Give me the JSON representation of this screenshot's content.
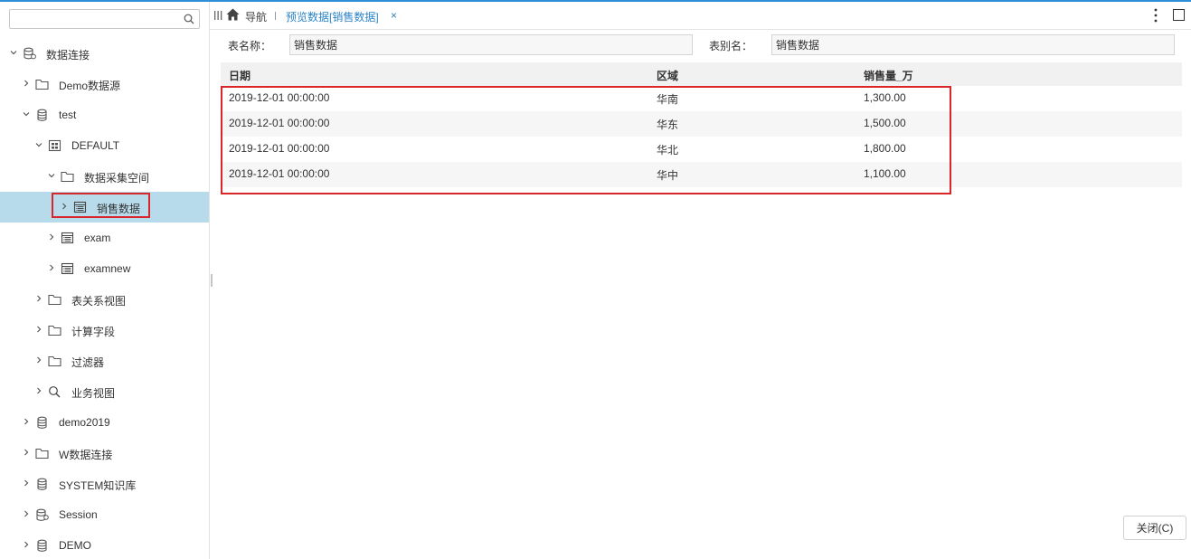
{
  "sidebar": {
    "search": {
      "placeholder": "",
      "value": ""
    },
    "tree": [
      {
        "label": "数据连接",
        "level": 0,
        "icon": "datasource-icon",
        "expanded": true
      },
      {
        "label": "Demo数据源",
        "level": 1,
        "icon": "folder-icon",
        "expanded": false
      },
      {
        "label": "test",
        "level": 1,
        "icon": "database-icon",
        "expanded": true
      },
      {
        "label": "DEFAULT",
        "level": 2,
        "icon": "schema-icon",
        "expanded": true
      },
      {
        "label": "数据采集空间",
        "level": 3,
        "icon": "folder-icon",
        "expanded": true
      },
      {
        "label": "销售数据",
        "level": 4,
        "icon": "table-icon",
        "expanded": false,
        "selected": true
      },
      {
        "label": "exam",
        "level": 3,
        "icon": "table-icon",
        "expanded": false
      },
      {
        "label": "examnew",
        "level": 3,
        "icon": "table-icon",
        "expanded": false
      },
      {
        "label": "表关系视图",
        "level": 2,
        "icon": "folder-icon",
        "expanded": false
      },
      {
        "label": "计算字段",
        "level": 2,
        "icon": "folder-icon",
        "expanded": false
      },
      {
        "label": "过滤器",
        "level": 2,
        "icon": "folder-icon",
        "expanded": false
      },
      {
        "label": "业务视图",
        "level": 2,
        "icon": "search-icon",
        "expanded": false
      },
      {
        "label": "demo2019",
        "level": 1,
        "icon": "database-icon",
        "expanded": false
      },
      {
        "label": "W数据连接",
        "level": 1,
        "icon": "folder-icon",
        "expanded": false
      },
      {
        "label": "SYSTEM知识库",
        "level": 1,
        "icon": "database-icon",
        "expanded": false
      },
      {
        "label": "Session",
        "level": 1,
        "icon": "session-db-icon",
        "expanded": false
      },
      {
        "label": "DEMO",
        "level": 1,
        "icon": "database-icon",
        "expanded": false
      }
    ]
  },
  "topbar": {
    "nav_label": "导航",
    "tab_label": "预览数据[销售数据]",
    "tab_close": "×"
  },
  "form": {
    "table_name_label": "表名称：",
    "table_name_value": "销售数据",
    "table_alias_label": "表别名：",
    "table_alias_value": "销售数据"
  },
  "table": {
    "columns": [
      "日期",
      "区域",
      "销售量_万"
    ],
    "rows": [
      [
        "2019-12-01 00:00:00",
        "华南",
        "1,300.00"
      ],
      [
        "2019-12-01 00:00:00",
        "华东",
        "1,500.00"
      ],
      [
        "2019-12-01 00:00:00",
        "华北",
        "1,800.00"
      ],
      [
        "2019-12-01 00:00:00",
        "华中",
        "1,100.00"
      ]
    ]
  },
  "footer": {
    "close_label": "关闭(C)"
  },
  "colors": {
    "accent": "#2b83c6",
    "selection": "#b7dbeb",
    "highlight_border": "#d9262b"
  }
}
